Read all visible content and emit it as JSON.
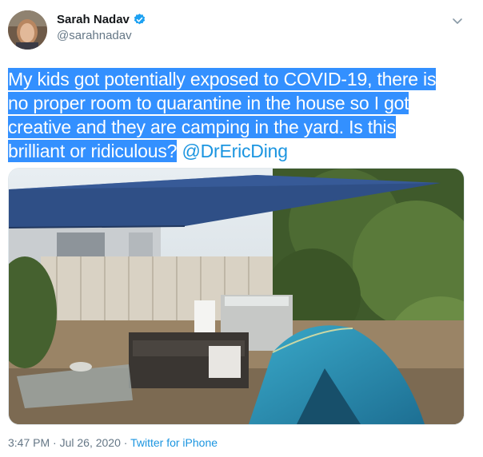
{
  "user": {
    "display_name": "Sarah Nadav",
    "handle": "@sarahnadav",
    "verified": true
  },
  "tweet": {
    "text_lines": [
      "My kids got potentially exposed to COVID-19, there is ",
      "no proper room to quarantine in the house so I got ",
      "creative and they are camping in the yard. Is this ",
      "brilliant or ridiculous?"
    ],
    "mention": "@DrEricDing",
    "timestamp": "3:47 PM · Jul 26, 2020",
    "separator": " · ",
    "source": "Twitter for iPhone"
  },
  "colors": {
    "selection": "#3390ff",
    "link": "#1b95e0",
    "secondary_text": "#657786",
    "verified_badge": "#1da1f2"
  },
  "icons": [
    "verified-badge-icon",
    "chevron-down-icon"
  ]
}
